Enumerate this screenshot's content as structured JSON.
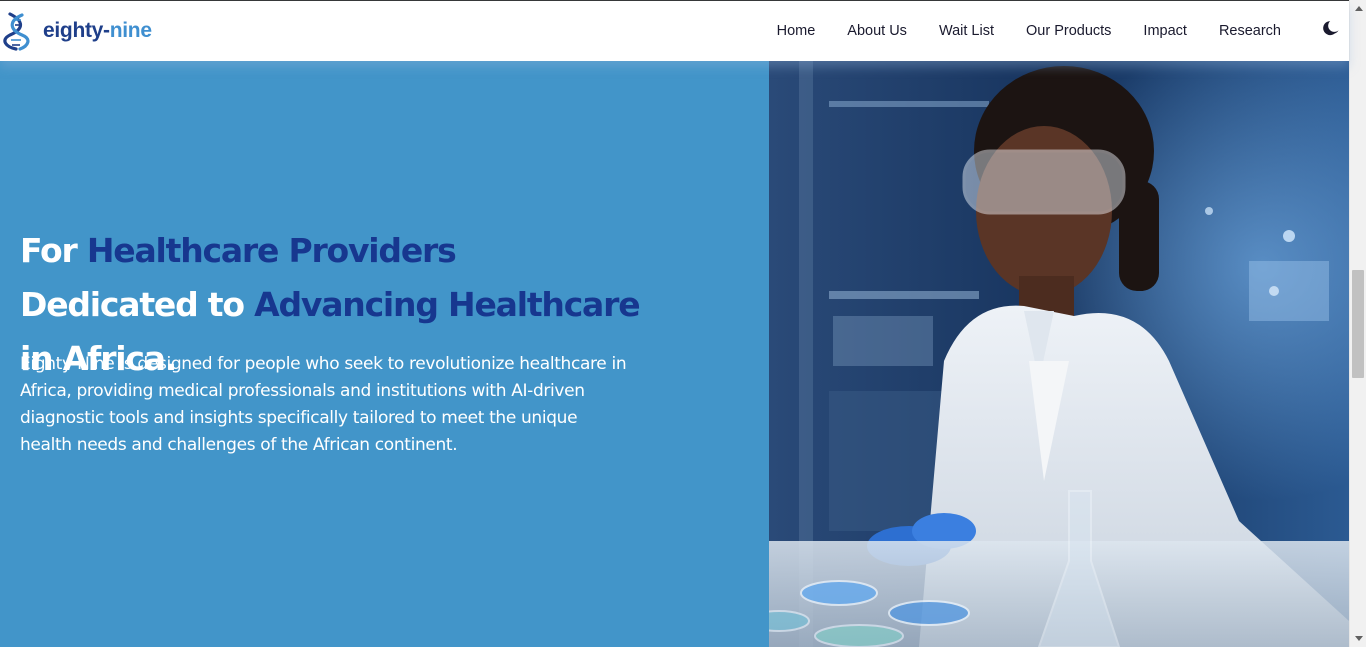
{
  "brand": {
    "name_part1": "eighty-",
    "name_part2": "nine",
    "logo_icon": "dna-icon",
    "color_dark": "#1f3f8a",
    "color_light": "#3f8fd0"
  },
  "nav": {
    "items": [
      {
        "label": "Home"
      },
      {
        "label": "About Us"
      },
      {
        "label": "Wait List"
      },
      {
        "label": "Our Products"
      },
      {
        "label": "Impact"
      },
      {
        "label": "Research"
      }
    ],
    "theme_toggle_icon": "moon-icon"
  },
  "hero": {
    "title": {
      "part1": "For ",
      "highlight1": "Healthcare Providers",
      "part2": " Dedicated to ",
      "highlight2": "Advancing Healthcare",
      "part3": " in Africa."
    },
    "description": "Eighty-Nine is designed for people who seek to revolutionize healthcare in Africa, providing medical professionals and institutions with AI-driven diagnostic tools and insights specifically tailored to meet the unique health needs and challenges of the African continent.",
    "background_color": "#4295c9",
    "highlight_color": "#17378f",
    "image": "laboratory-scientist-photo"
  }
}
